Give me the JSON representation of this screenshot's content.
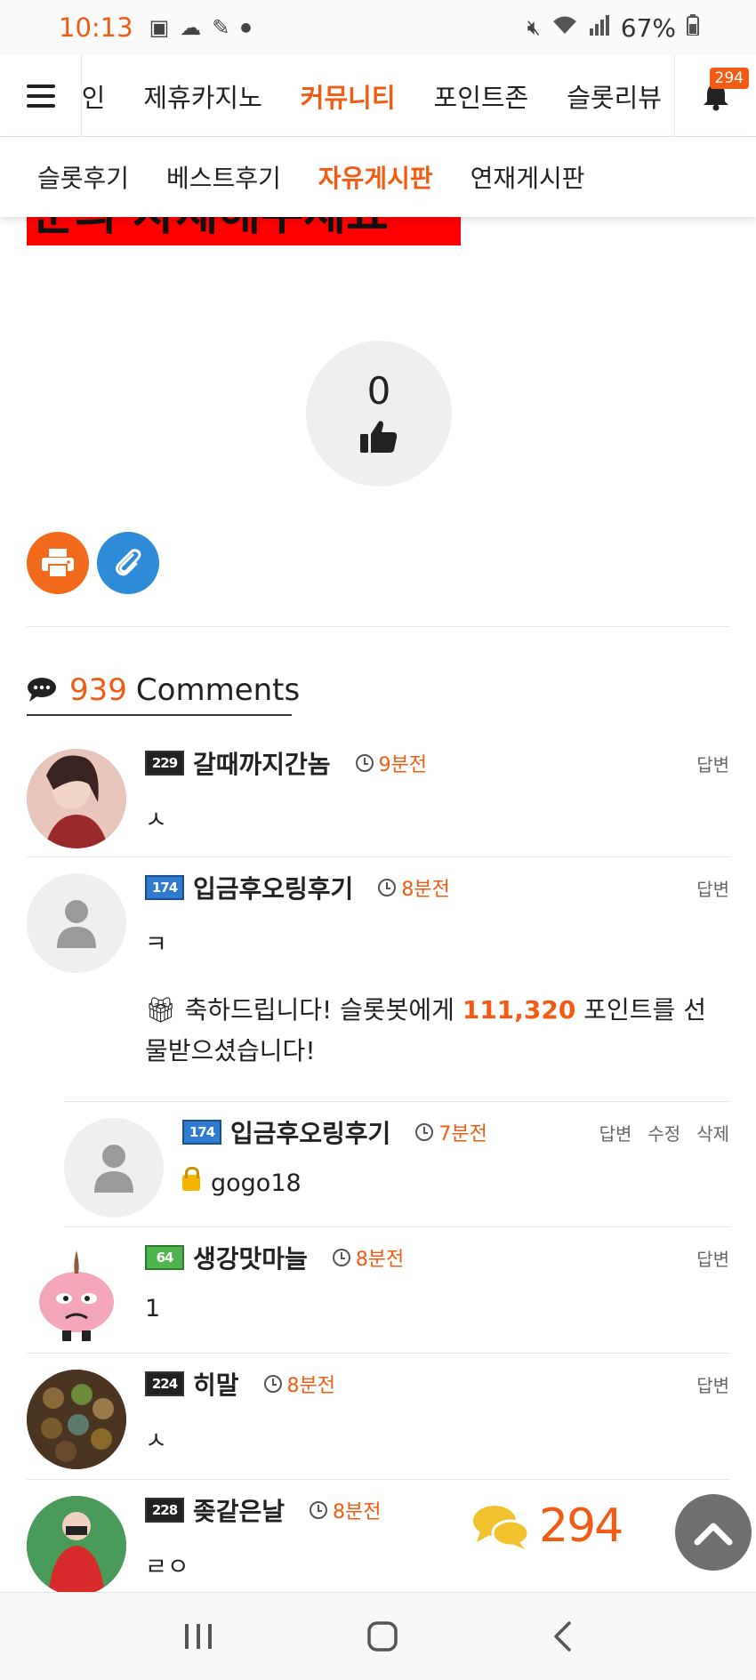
{
  "status": {
    "time": "10:13",
    "battery": "67%"
  },
  "header": {
    "nav_items": [
      "메인",
      "제휴카지노",
      "커뮤니티",
      "포인트존",
      "슬롯리뷰"
    ],
    "active_index": 2,
    "bell_badge": "294"
  },
  "subnav": {
    "items": [
      "슬롯후기",
      "베스트후기",
      "자유게시판",
      "연재게시판"
    ],
    "active_index": 2
  },
  "post": {
    "banner_text": "문의 자제해주세요",
    "like_count": "0"
  },
  "comments": {
    "count": "939",
    "label": "Comments",
    "reply_label": "답변",
    "edit_label": "수정",
    "delete_label": "삭제",
    "items": [
      {
        "level": "229",
        "name": "갈때까지간놈",
        "time": "9분전",
        "text": "ㅅ"
      },
      {
        "level": "174",
        "name": "입금후오링후기",
        "time": "8분전",
        "text": "ㅋ",
        "gift_prefix": "축하드립니다! 슬롯봇에게 ",
        "gift_points": "111,320",
        "gift_suffix": " 포인트를 선물받으셨습니다!"
      },
      {
        "level": "174",
        "name": "입금후오링후기",
        "time": "7분전",
        "text": "gogo18"
      },
      {
        "level": "64",
        "name": "생강맛마늘",
        "time": "8분전",
        "text": "1"
      },
      {
        "level": "224",
        "name": "히말",
        "time": "8분전",
        "text": "ㅅ"
      },
      {
        "level": "228",
        "name": "좆같은날",
        "time": "8분전",
        "text": "ㄹㅇ"
      }
    ]
  },
  "floating": {
    "comment_count": "294"
  },
  "colors": {
    "accent": "#f25b13",
    "print": "#f26a1b",
    "clip": "#2e8bd8"
  }
}
